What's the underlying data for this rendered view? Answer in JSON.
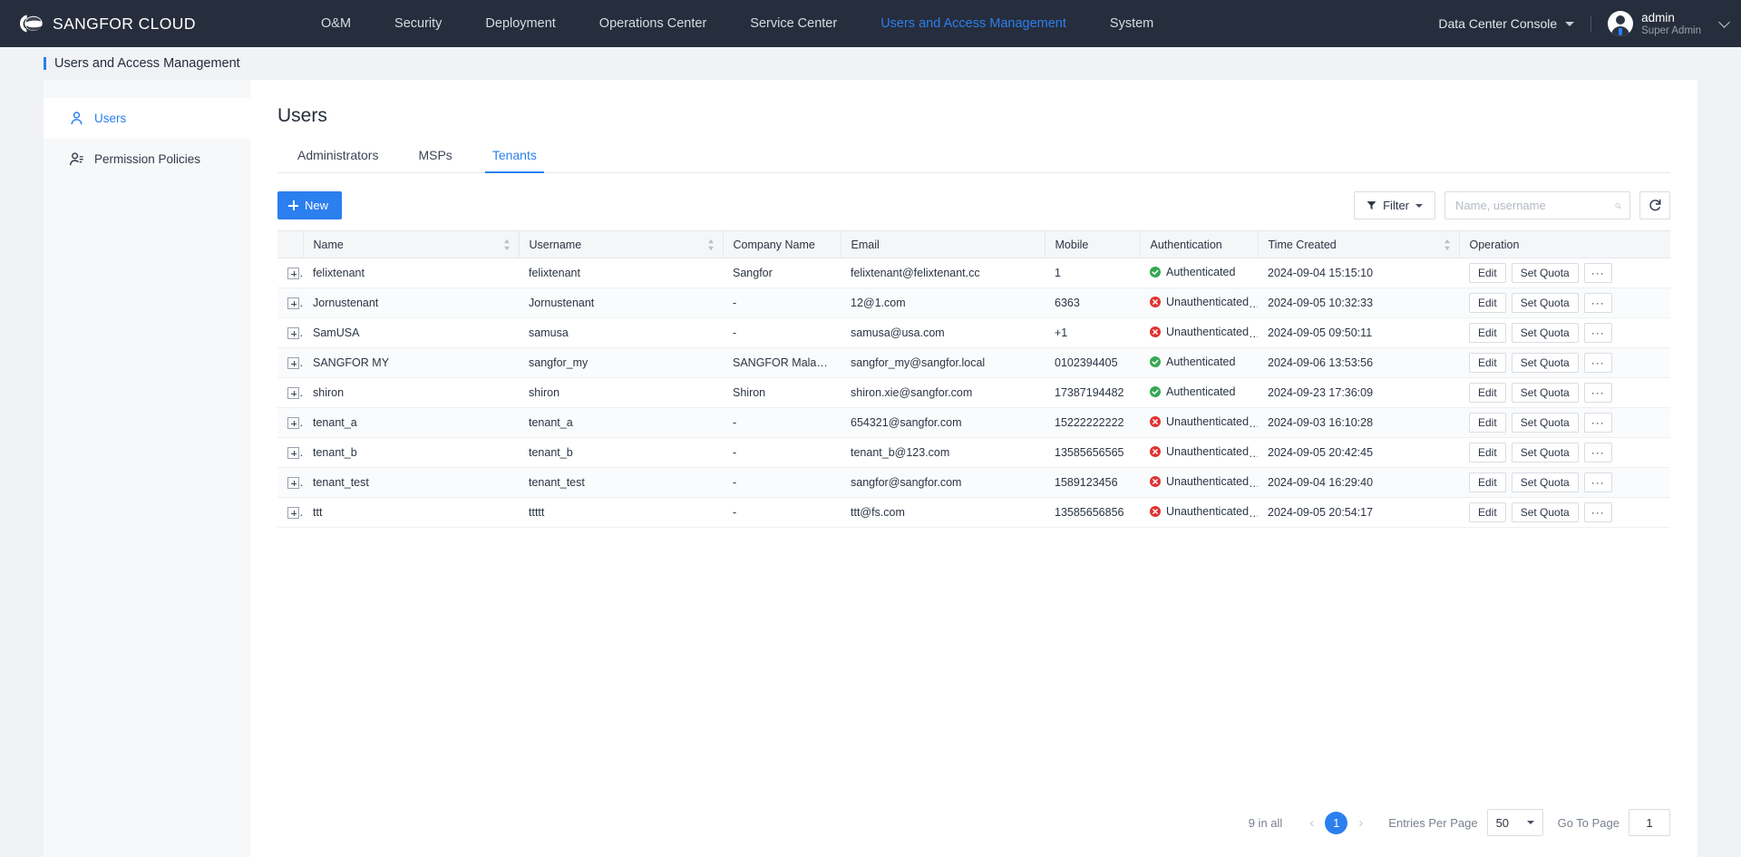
{
  "brand": {
    "name": "SANGFOR CLOUD",
    "logo_icon": "cloud-logo-icon"
  },
  "topnav": {
    "items": [
      {
        "label": "O&M",
        "active": false
      },
      {
        "label": "Security",
        "active": false
      },
      {
        "label": "Deployment",
        "active": false
      },
      {
        "label": "Operations Center",
        "active": false
      },
      {
        "label": "Service Center",
        "active": false
      },
      {
        "label": "Users and Access Management",
        "active": true
      },
      {
        "label": "System",
        "active": false
      }
    ],
    "console_selector": "Data Center Console",
    "user": {
      "name": "admin",
      "role": "Super Admin",
      "avatar_icon": "avatar"
    }
  },
  "page": {
    "title": "Users and Access Management"
  },
  "sidebar": {
    "items": [
      {
        "label": "Users",
        "icon": "user-icon",
        "active": true
      },
      {
        "label": "Permission Policies",
        "icon": "user-permission-icon",
        "active": false
      }
    ]
  },
  "main": {
    "heading": "Users",
    "tabs": [
      {
        "label": "Administrators",
        "active": false
      },
      {
        "label": "MSPs",
        "active": false
      },
      {
        "label": "Tenants",
        "active": true
      }
    ],
    "toolbar": {
      "new_label": "New",
      "filter_label": "Filter",
      "search_placeholder": "Name, username",
      "search_value": "",
      "search_icon": "search-icon",
      "refresh_icon": "refresh-icon",
      "filter_icon": "funnel-icon"
    },
    "table": {
      "columns": [
        {
          "label": "",
          "sortable": false
        },
        {
          "label": "Name",
          "sortable": true
        },
        {
          "label": "Username",
          "sortable": true
        },
        {
          "label": "Company Name",
          "sortable": false
        },
        {
          "label": "Email",
          "sortable": false
        },
        {
          "label": "Mobile",
          "sortable": false
        },
        {
          "label": "Authentication",
          "sortable": false
        },
        {
          "label": "Time Created",
          "sortable": true
        },
        {
          "label": "Operation",
          "sortable": false
        }
      ],
      "row_actions": {
        "edit": "Edit",
        "quota": "Set Quota",
        "more": "···"
      },
      "rows": [
        {
          "name": "felixtenant",
          "username": "felixtenant",
          "company": "Sangfor",
          "email": "felixtenant@felixtenant.cc",
          "mobile": "1",
          "auth": "Authenticated",
          "created": "2024-09-04 15:15:10"
        },
        {
          "name": "Jornustenant",
          "username": "Jornustenant",
          "company": "-",
          "email": "12@1.com",
          "mobile": "6363",
          "auth": "Unauthenticated",
          "created": "2024-09-05 10:32:33"
        },
        {
          "name": "SamUSA",
          "username": "samusa",
          "company": "-",
          "email": "samusa@usa.com",
          "mobile": "+1",
          "auth": "Unauthenticated",
          "created": "2024-09-05 09:50:11"
        },
        {
          "name": "SANGFOR MY",
          "username": "sangfor_my",
          "company": "SANGFOR Malaysia",
          "email": "sangfor_my@sangfor.local",
          "mobile": "0102394405",
          "auth": "Authenticated",
          "created": "2024-09-06 13:53:56"
        },
        {
          "name": "shiron",
          "username": "shiron",
          "company": "Shiron",
          "email": "shiron.xie@sangfor.com",
          "mobile": "17387194482",
          "auth": "Authenticated",
          "created": "2024-09-23 17:36:09"
        },
        {
          "name": "tenant_a",
          "username": "tenant_a",
          "company": "-",
          "email": "654321@sangfor.com",
          "mobile": "15222222222",
          "auth": "Unauthenticated",
          "created": "2024-09-03 16:10:28"
        },
        {
          "name": "tenant_b",
          "username": "tenant_b",
          "company": "-",
          "email": "tenant_b@123.com",
          "mobile": "13585656565",
          "auth": "Unauthenticated",
          "created": "2024-09-05 20:42:45"
        },
        {
          "name": "tenant_test",
          "username": "tenant_test",
          "company": "-",
          "email": "sangfor@sangfor.com",
          "mobile": "1589123456",
          "auth": "Unauthenticated",
          "created": "2024-09-04 16:29:40"
        },
        {
          "name": "ttt",
          "username": "ttttt",
          "company": "-",
          "email": "ttt@fs.com",
          "mobile": "13585656856",
          "auth": "Unauthenticated",
          "created": "2024-09-05 20:54:17"
        }
      ]
    },
    "pagination": {
      "total_text": "9 in all",
      "prev": "‹",
      "next": "›",
      "current_page": "1",
      "per_page_label": "Entries Per Page",
      "per_page_value": "50",
      "goto_label": "Go To Page",
      "goto_value": "1"
    }
  },
  "colors": {
    "accent": "#2b7fee",
    "nav_bg": "#262d3c",
    "page_bg": "#f0f2f5",
    "ok": "#34a853",
    "error": "#e03131",
    "border": "#d9dde3"
  }
}
